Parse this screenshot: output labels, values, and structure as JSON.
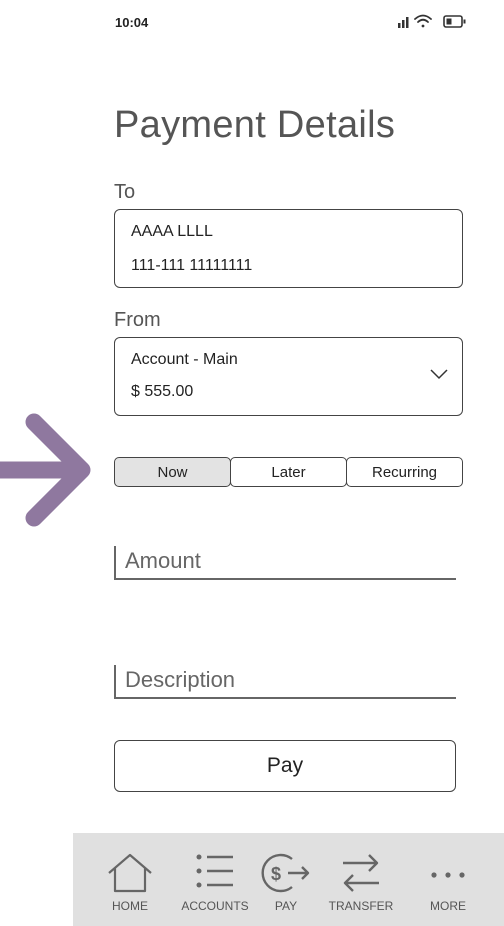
{
  "status_bar": {
    "time": "10:04"
  },
  "header": {
    "title": "Payment Details"
  },
  "to": {
    "label": "To",
    "name": "AAAA LLLL",
    "account_number": "111-111 11111111"
  },
  "from": {
    "label": "From",
    "account": "Account - Main",
    "balance": "$ 555.00"
  },
  "timing": {
    "options": [
      "Now",
      "Later",
      "Recurring"
    ],
    "selected": "Now"
  },
  "amount": {
    "placeholder": "Amount"
  },
  "description": {
    "placeholder": "Description"
  },
  "pay_button": {
    "label": "Pay"
  },
  "bottom_nav": {
    "items": [
      {
        "label": "HOME",
        "icon": "home-icon"
      },
      {
        "label": "ACCOUNTS",
        "icon": "list-icon"
      },
      {
        "label": "PAY",
        "icon": "pay-icon"
      },
      {
        "label": "TRANSFER",
        "icon": "transfer-icon"
      },
      {
        "label": "MORE",
        "icon": "more-icon"
      }
    ]
  },
  "colors": {
    "arrow": "#8f789f",
    "nav_background": "#e0e0e0",
    "selected_segment": "#e3e3e3"
  }
}
